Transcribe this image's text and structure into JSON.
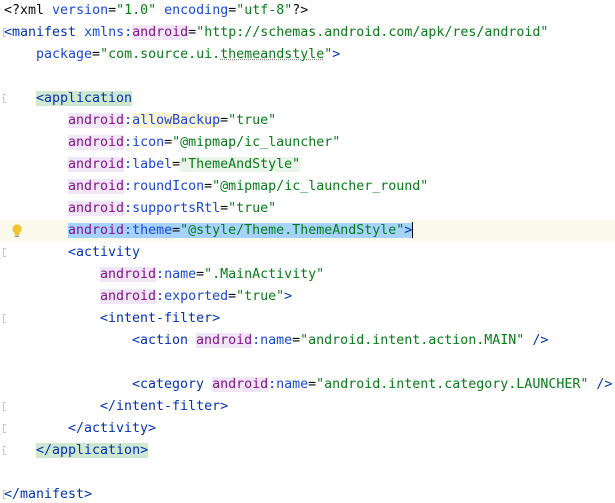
{
  "editor": {
    "lines": [
      {
        "indent": 0,
        "tokens": [
          {
            "t": "<?",
            "c": "pi"
          },
          {
            "t": "xml ",
            "c": "pi"
          },
          {
            "t": "version",
            "c": "attr"
          },
          {
            "t": "=",
            "c": "punc"
          },
          {
            "t": "\"1.0\"",
            "c": "val"
          },
          {
            "t": " ",
            "c": "punc"
          },
          {
            "t": "encoding",
            "c": "attr"
          },
          {
            "t": "=",
            "c": "punc"
          },
          {
            "t": "\"utf-8\"",
            "c": "val"
          },
          {
            "t": "?>",
            "c": "pi"
          }
        ]
      },
      {
        "indent": 0,
        "tokens": [
          {
            "t": "<",
            "c": "tag"
          },
          {
            "t": "manifest",
            "c": "tag"
          },
          {
            "t": " ",
            "c": "punc"
          },
          {
            "t": "xmlns:",
            "c": "attr"
          },
          {
            "t": "android",
            "c": "ns ns-bg"
          },
          {
            "t": "=",
            "c": "punc"
          },
          {
            "t": "\"http://schemas.android.com/apk/res/android\"",
            "c": "val"
          }
        ]
      },
      {
        "indent": 1,
        "tokens": [
          {
            "t": "package",
            "c": "attr"
          },
          {
            "t": "=",
            "c": "punc"
          },
          {
            "t": "\"com.source.ui.",
            "c": "val"
          },
          {
            "t": "themeandstyle",
            "c": "val underline"
          },
          {
            "t": "\"",
            "c": "val"
          },
          {
            "t": ">",
            "c": "tag"
          }
        ]
      },
      {
        "indent": 0,
        "tokens": []
      },
      {
        "indent": 1,
        "tokens": [
          {
            "t": "<application",
            "c": "tag hl-tag-strong"
          }
        ]
      },
      {
        "indent": 2,
        "tokens": [
          {
            "t": "android",
            "c": "ns ns-bg"
          },
          {
            "t": ":",
            "c": "attr"
          },
          {
            "t": "allowBackup",
            "c": "attr hl-attr-yellow"
          },
          {
            "t": "=",
            "c": "punc"
          },
          {
            "t": "\"true\"",
            "c": "val"
          }
        ]
      },
      {
        "indent": 2,
        "tokens": [
          {
            "t": "android",
            "c": "ns ns-bg"
          },
          {
            "t": ":",
            "c": "attr"
          },
          {
            "t": "icon",
            "c": "attr"
          },
          {
            "t": "=",
            "c": "punc"
          },
          {
            "t": "\"@mipmap/ic_launcher\"",
            "c": "val"
          }
        ]
      },
      {
        "indent": 2,
        "tokens": [
          {
            "t": "android",
            "c": "ns ns-bg"
          },
          {
            "t": ":",
            "c": "attr"
          },
          {
            "t": "label",
            "c": "attr"
          },
          {
            "t": "=",
            "c": "punc"
          },
          {
            "t": "\"ThemeAndStyle\"",
            "c": "val hl-val-green"
          }
        ]
      },
      {
        "indent": 2,
        "tokens": [
          {
            "t": "android",
            "c": "ns ns-bg"
          },
          {
            "t": ":",
            "c": "attr"
          },
          {
            "t": "roundIcon",
            "c": "attr"
          },
          {
            "t": "=",
            "c": "punc"
          },
          {
            "t": "\"@mipmap/ic_launcher_round\"",
            "c": "val"
          }
        ]
      },
      {
        "indent": 2,
        "tokens": [
          {
            "t": "android",
            "c": "ns ns-bg"
          },
          {
            "t": ":",
            "c": "attr"
          },
          {
            "t": "supportsRtl",
            "c": "attr"
          },
          {
            "t": "=",
            "c": "punc"
          },
          {
            "t": "\"true\"",
            "c": "val"
          }
        ]
      },
      {
        "indent": 2,
        "caret": true,
        "bulb": true,
        "tokens": [
          {
            "t": "android",
            "c": "ns sel"
          },
          {
            "t": ":",
            "c": "attr sel"
          },
          {
            "t": "theme",
            "c": "attr sel"
          },
          {
            "t": "=",
            "c": "punc sel"
          },
          {
            "t": "\"@style/Theme.ThemeAndStyle\"",
            "c": "val sel"
          },
          {
            "t": ">",
            "c": "tag sel"
          },
          {
            "t": "",
            "c": "cursor"
          }
        ]
      },
      {
        "indent": 2,
        "tokens": [
          {
            "t": "<activity",
            "c": "tag"
          }
        ]
      },
      {
        "indent": 3,
        "tokens": [
          {
            "t": "android",
            "c": "ns ns-bg"
          },
          {
            "t": ":",
            "c": "attr"
          },
          {
            "t": "name",
            "c": "attr"
          },
          {
            "t": "=",
            "c": "punc"
          },
          {
            "t": "\".MainActivity\"",
            "c": "val"
          }
        ]
      },
      {
        "indent": 3,
        "tokens": [
          {
            "t": "android",
            "c": "ns ns-bg"
          },
          {
            "t": ":",
            "c": "attr"
          },
          {
            "t": "exported",
            "c": "attr"
          },
          {
            "t": "=",
            "c": "punc"
          },
          {
            "t": "\"true\"",
            "c": "val"
          },
          {
            "t": ">",
            "c": "tag"
          }
        ]
      },
      {
        "indent": 3,
        "tokens": [
          {
            "t": "<intent-filter",
            "c": "tag"
          },
          {
            "t": ">",
            "c": "tag"
          }
        ]
      },
      {
        "indent": 4,
        "tokens": [
          {
            "t": "<action ",
            "c": "tag"
          },
          {
            "t": "android",
            "c": "ns ns-bg"
          },
          {
            "t": ":",
            "c": "attr"
          },
          {
            "t": "name",
            "c": "attr"
          },
          {
            "t": "=",
            "c": "punc"
          },
          {
            "t": "\"android.intent.action.MAIN\"",
            "c": "val"
          },
          {
            "t": " />",
            "c": "tag"
          }
        ]
      },
      {
        "indent": 0,
        "tokens": []
      },
      {
        "indent": 4,
        "tokens": [
          {
            "t": "<category ",
            "c": "tag"
          },
          {
            "t": "android",
            "c": "ns ns-bg"
          },
          {
            "t": ":",
            "c": "attr"
          },
          {
            "t": "name",
            "c": "attr"
          },
          {
            "t": "=",
            "c": "punc"
          },
          {
            "t": "\"android.intent.category.LAUNCHER\"",
            "c": "val"
          },
          {
            "t": " />",
            "c": "tag"
          }
        ]
      },
      {
        "indent": 3,
        "tokens": [
          {
            "t": "</intent-filter>",
            "c": "tag"
          }
        ]
      },
      {
        "indent": 2,
        "tokens": [
          {
            "t": "</activity>",
            "c": "tag"
          }
        ]
      },
      {
        "indent": 1,
        "tokens": [
          {
            "t": "</application>",
            "c": "tag hl-tag-strong"
          }
        ]
      },
      {
        "indent": 0,
        "tokens": []
      },
      {
        "indent": 0,
        "tokens": [
          {
            "t": "</manifest>",
            "c": "tag"
          }
        ]
      }
    ],
    "gutter_marks": [
      1,
      4,
      11,
      14,
      18,
      19,
      20,
      22
    ],
    "icons": {
      "bulb": "lightbulb-icon",
      "fold": "fold-marker-icon"
    },
    "colors": {
      "tag": "#0033b3",
      "namespace": "#871094",
      "attribute": "#174ad4",
      "value": "#067d17",
      "selection": "#a6d2ff",
      "caret_line": "#fcfaed"
    }
  }
}
